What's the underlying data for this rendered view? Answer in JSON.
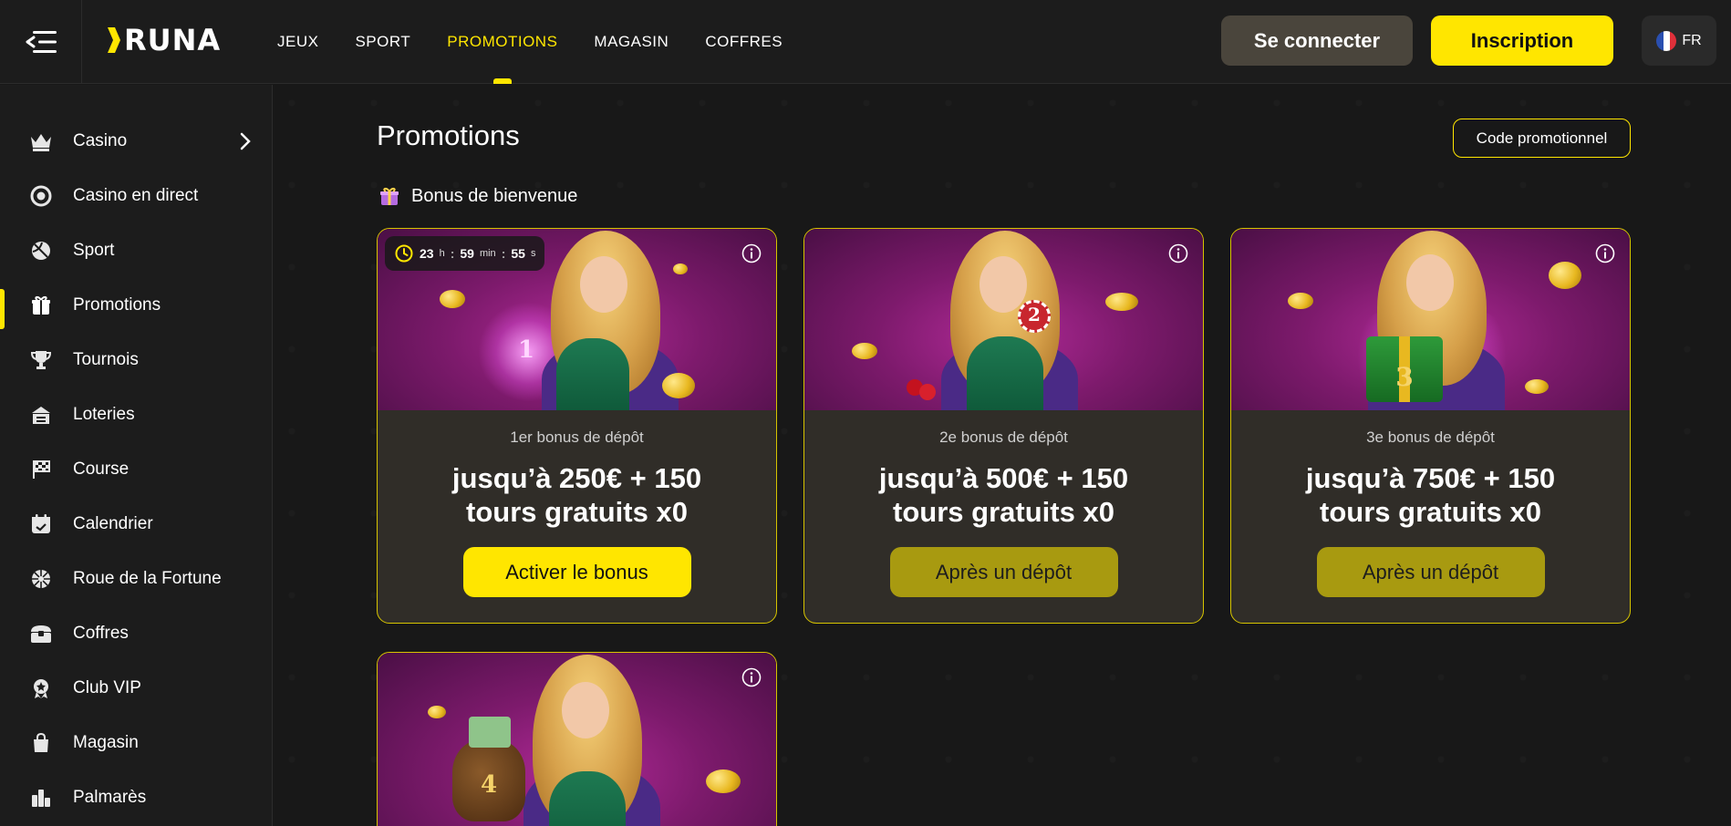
{
  "header": {
    "logo": "RUNA",
    "nav": [
      {
        "label": "JEUX"
      },
      {
        "label": "SPORT"
      },
      {
        "label": "PROMOTIONS",
        "active": true
      },
      {
        "label": "MAGASIN"
      },
      {
        "label": "COFFRES"
      }
    ],
    "login_label": "Se connecter",
    "register_label": "Inscription",
    "language": "FR"
  },
  "sidebar": {
    "items": [
      {
        "label": "Casino",
        "icon": "crown-icon",
        "has_chevron": true
      },
      {
        "label": "Casino en direct",
        "icon": "live-chip-icon"
      },
      {
        "label": "Sport",
        "icon": "ball-icon"
      },
      {
        "label": "Promotions",
        "icon": "gift-icon",
        "active": true
      },
      {
        "label": "Tournois",
        "icon": "trophy-icon"
      },
      {
        "label": "Loteries",
        "icon": "lottery-icon"
      },
      {
        "label": "Course",
        "icon": "race-flag-icon"
      },
      {
        "label": "Calendrier",
        "icon": "calendar-icon"
      },
      {
        "label": "Roue de la Fortune",
        "icon": "wheel-icon"
      },
      {
        "label": "Coffres",
        "icon": "chest-icon"
      },
      {
        "label": "Club VIP",
        "icon": "vip-badge-icon"
      },
      {
        "label": "Magasin",
        "icon": "shop-bag-icon"
      },
      {
        "label": "Palmarès",
        "icon": "leaderboard-icon"
      }
    ]
  },
  "main": {
    "title": "Promotions",
    "promo_code_label": "Code promotionnel",
    "section_title": "Bonus de bienvenue",
    "cards": [
      {
        "subtitle": "1er bonus de dépôt",
        "title_line1": "jusqu’à 250€ + 150",
        "title_line2": "tours gratuits x0",
        "button_label": "Activer le bonus",
        "button_state": "primary",
        "timer": {
          "hours": "23",
          "h_unit": "h",
          "minutes": "59",
          "m_unit": "min",
          "seconds": "55",
          "s_unit": "s"
        },
        "badge_number": "1"
      },
      {
        "subtitle": "2e bonus de dépôt",
        "title_line1": "jusqu’à 500€ + 150",
        "title_line2": "tours gratuits x0",
        "button_label": "Après un dépôt",
        "button_state": "disabled",
        "badge_number": "2"
      },
      {
        "subtitle": "3e bonus de dépôt",
        "title_line1": "jusqu’à 750€ + 150",
        "title_line2": "tours gratuits x0",
        "button_label": "Après un dépôt",
        "button_state": "disabled",
        "badge_number": "3"
      },
      {
        "badge_number": "4"
      }
    ]
  },
  "colors": {
    "accent": "#ffe600",
    "background": "#181818",
    "card_bg": "#302d28",
    "disabled_button": "#a89a10"
  }
}
